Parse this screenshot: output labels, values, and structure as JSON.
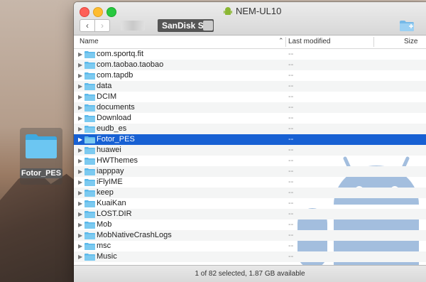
{
  "window": {
    "title": "NEM-UL10",
    "device_label": "SanDisk SD",
    "title_icon": "android-icon",
    "new_folder_icon": "new-folder-icon"
  },
  "desktop": {
    "folder_label": "Fotor_PES"
  },
  "columns": {
    "name": "Name",
    "modified": "Last modified",
    "size": "Size"
  },
  "files": [
    {
      "name": "com.sportq.fit",
      "modified": "--",
      "size": "--"
    },
    {
      "name": "com.taobao.taobao",
      "modified": "--",
      "size": "--"
    },
    {
      "name": "com.tapdb",
      "modified": "--",
      "size": "--"
    },
    {
      "name": "data",
      "modified": "--",
      "size": "--"
    },
    {
      "name": "DCIM",
      "modified": "--",
      "size": "--"
    },
    {
      "name": "documents",
      "modified": "--",
      "size": "--"
    },
    {
      "name": "Download",
      "modified": "--",
      "size": "--"
    },
    {
      "name": "eudb_es",
      "modified": "--",
      "size": "--"
    },
    {
      "name": "Fotor_PES",
      "modified": "--",
      "size": "--",
      "selected": true
    },
    {
      "name": "huawei",
      "modified": "--",
      "size": "--"
    },
    {
      "name": "HWThemes",
      "modified": "--",
      "size": "--"
    },
    {
      "name": "iapppay",
      "modified": "--",
      "size": "--"
    },
    {
      "name": "iFlyIME",
      "modified": "--",
      "size": "--"
    },
    {
      "name": "keep",
      "modified": "--",
      "size": "--"
    },
    {
      "name": "KuaiKan",
      "modified": "--",
      "size": "--"
    },
    {
      "name": "LOST.DIR",
      "modified": "--",
      "size": "--"
    },
    {
      "name": "Mob",
      "modified": "--",
      "size": "--"
    },
    {
      "name": "MobNativeCrashLogs",
      "modified": "--",
      "size": "--"
    },
    {
      "name": "msc",
      "modified": "--",
      "size": "--"
    },
    {
      "name": "Music",
      "modified": "--",
      "size": "--"
    }
  ],
  "status": {
    "text": "1 of 82 selected, 1.87 GB available"
  },
  "colors": {
    "selection": "#1760d3",
    "folder": "#5ab8ea"
  }
}
